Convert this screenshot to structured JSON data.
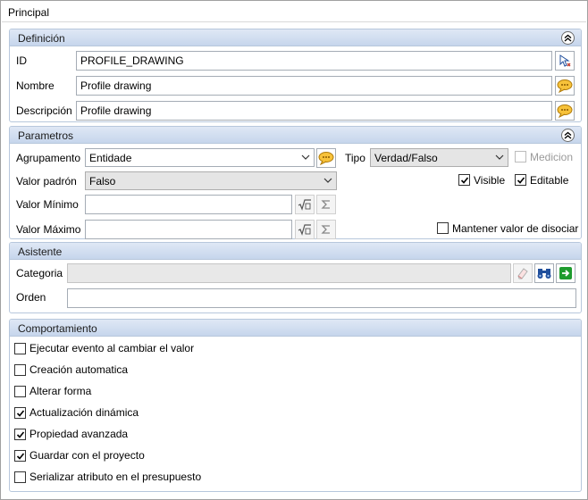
{
  "window": {
    "title": "Principal"
  },
  "definicion": {
    "header": "Definición",
    "id_label": "ID",
    "id_value": "PROFILE_DRAWING",
    "nombre_label": "Nombre",
    "nombre_value": "Profile drawing",
    "descripcion_label": "Descripción",
    "descripcion_value": "Profile drawing"
  },
  "parametros": {
    "header": "Parametros",
    "agrupamento_label": "Agrupamento",
    "agrupamento_value": "Entidade",
    "tipo_label": "Tipo",
    "tipo_value": "Verdad/Falso",
    "medicion_label": "Medicion",
    "medicion_checked": false,
    "valor_padron_label": "Valor padrón",
    "valor_padron_value": "Falso",
    "visible_label": "Visible",
    "visible_checked": true,
    "editable_label": "Editable",
    "editable_checked": true,
    "valor_minimo_label": "Valor Mínimo",
    "valor_minimo_value": "",
    "valor_maximo_label": "Valor Máximo",
    "valor_maximo_value": "",
    "mantener_label": "Mantener valor de disociar",
    "mantener_checked": false
  },
  "asistente": {
    "header": "Asistente",
    "categoria_label": "Categoria",
    "categoria_value": "",
    "orden_label": "Orden",
    "orden_value": ""
  },
  "comportamiento": {
    "header": "Comportamiento",
    "items": [
      {
        "label": "Ejecutar evento al cambiar el valor",
        "checked": false
      },
      {
        "label": "Creación automatica",
        "checked": false
      },
      {
        "label": "Alterar forma",
        "checked": false
      },
      {
        "label": "Actualización dinámica",
        "checked": true
      },
      {
        "label": "Propiedad avanzada",
        "checked": true
      },
      {
        "label": "Guardar con el proyecto",
        "checked": true
      },
      {
        "label": "Serializar atributo en el presupuesto",
        "checked": false
      }
    ]
  },
  "colors": {
    "header_top": "#dfe8f5",
    "header_bottom": "#c6d6ec",
    "group_border": "#b7c7dc",
    "accent_green": "#1e9b2e",
    "binoculars_blue": "#1f4e9c"
  }
}
